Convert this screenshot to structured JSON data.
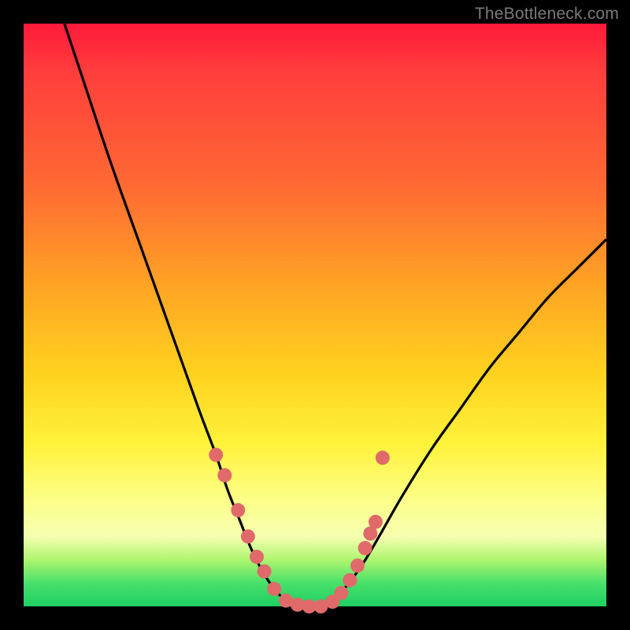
{
  "watermark": "TheBottleneck.com",
  "colors": {
    "background": "#000000",
    "curve": "#000000",
    "marker_fill": "#e06a6a",
    "marker_stroke": "#c95d5d"
  },
  "chart_data": {
    "type": "line",
    "title": "",
    "xlabel": "",
    "ylabel": "",
    "xlim": [
      0,
      100
    ],
    "ylim": [
      0,
      100
    ],
    "note": "V-shaped bottleneck curve. y≈100 means high bottleneck (top, red), y≈0 means ideal (bottom, green). Approximate values read from pixel positions.",
    "series": [
      {
        "name": "bottleneck-curve",
        "x": [
          7,
          10,
          15,
          20,
          25,
          30,
          33,
          35,
          37,
          39,
          41,
          43,
          45,
          47,
          49,
          51,
          53,
          55,
          58,
          61,
          65,
          70,
          75,
          80,
          85,
          90,
          95,
          100
        ],
        "y": [
          100,
          91,
          76,
          62,
          48,
          34,
          26,
          20,
          15,
          10,
          6,
          3,
          1,
          0,
          0,
          0,
          1,
          3,
          7,
          12,
          19,
          27,
          34,
          41,
          47,
          53,
          58,
          63
        ]
      }
    ],
    "markers": {
      "name": "highlighted-points",
      "x": [
        33.0,
        34.5,
        36.8,
        38.5,
        40.0,
        41.3,
        43.0,
        45.0,
        47.0,
        49.0,
        51.0,
        53.0,
        54.5,
        56.0,
        57.3,
        58.6,
        59.5,
        60.4,
        61.6
      ],
      "y": [
        26.0,
        22.5,
        16.5,
        12.0,
        8.5,
        6.0,
        3.0,
        1.0,
        0.3,
        0.0,
        0.0,
        0.8,
        2.3,
        4.5,
        7.0,
        10.0,
        12.5,
        14.5,
        25.5
      ]
    }
  }
}
